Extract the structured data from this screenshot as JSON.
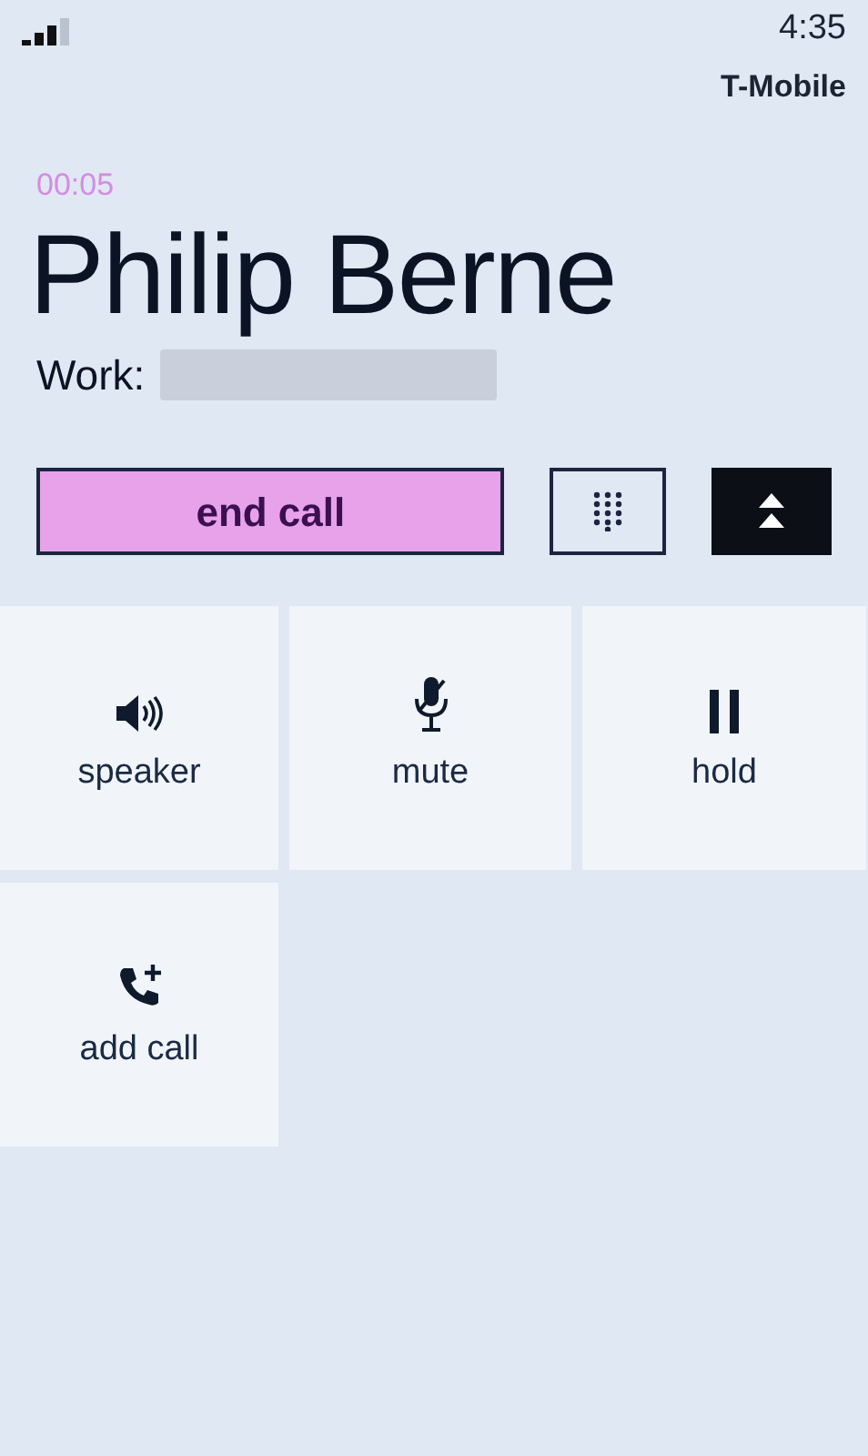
{
  "status_bar": {
    "time": "4:35",
    "carrier": "T-Mobile"
  },
  "call": {
    "duration": "00:05",
    "name": "Philip Berne",
    "number_label": "Work:"
  },
  "end_call_button": {
    "label": "end call"
  },
  "actions": [
    {
      "kind": "speaker",
      "label": "speaker"
    },
    {
      "kind": "mute",
      "label": "mute"
    },
    {
      "kind": "hold",
      "label": "hold"
    },
    {
      "kind": "add_call",
      "label": "add call"
    }
  ]
}
